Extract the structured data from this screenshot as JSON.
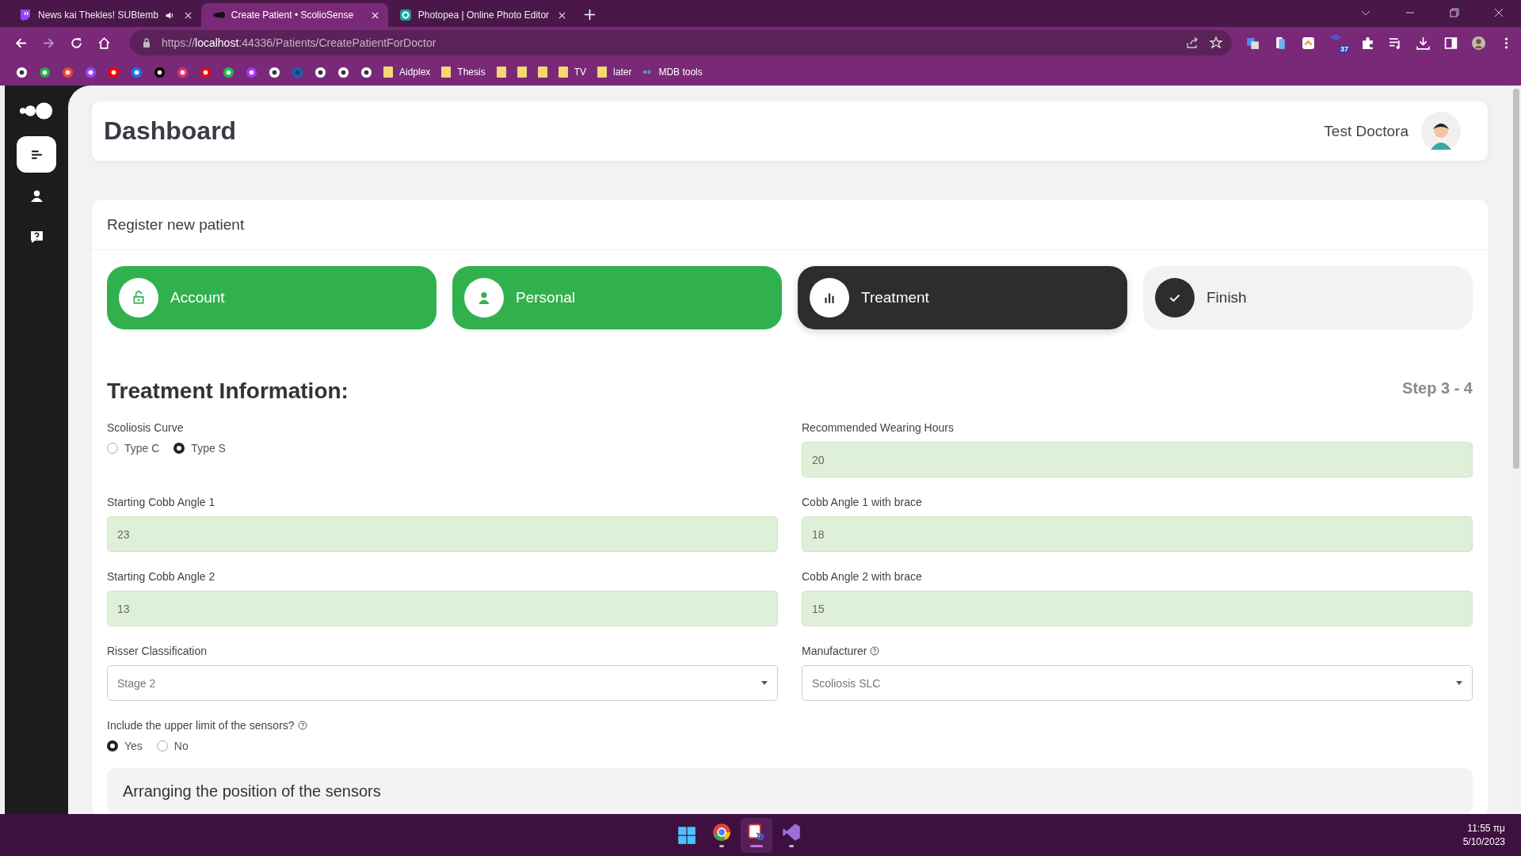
{
  "browser": {
    "tabs": [
      {
        "title": "News kai Thekles! SUBtemb",
        "kind": "stream",
        "audio": true,
        "selected": false
      },
      {
        "title": "Create Patient • ScolioSense",
        "kind": "app",
        "audio": false,
        "selected": true
      },
      {
        "title": "Photopea | Online Photo Editor",
        "kind": "editor",
        "audio": false,
        "selected": false
      }
    ],
    "url": {
      "scheme": "https://",
      "host": "localhost",
      "rest": ":44336/Patients/CreatePatientForDoctor"
    },
    "extension_badge": "37",
    "bookmarks": [
      {
        "kind": "site"
      },
      {
        "kind": "site"
      },
      {
        "kind": "site"
      },
      {
        "kind": "site"
      },
      {
        "kind": "site"
      },
      {
        "kind": "site"
      },
      {
        "kind": "site"
      },
      {
        "kind": "site"
      },
      {
        "kind": "site"
      },
      {
        "kind": "site"
      },
      {
        "kind": "site"
      },
      {
        "kind": "site"
      },
      {
        "kind": "site"
      },
      {
        "kind": "site"
      },
      {
        "kind": "site"
      },
      {
        "kind": "site"
      },
      {
        "kind": "folder",
        "label": "Aidplex"
      },
      {
        "kind": "folder",
        "label": "Thesis"
      },
      {
        "kind": "folder"
      },
      {
        "kind": "folder"
      },
      {
        "kind": "folder"
      },
      {
        "kind": "folder",
        "label": "TV"
      },
      {
        "kind": "folder",
        "label": "later"
      },
      {
        "kind": "site",
        "label": "MDB tools"
      }
    ]
  },
  "sidebar": {
    "items": [
      {
        "kind": "dashboard",
        "selected": true
      },
      {
        "kind": "profile",
        "selected": false
      },
      {
        "kind": "help",
        "selected": false
      }
    ]
  },
  "header": {
    "title": "Dashboard",
    "user": "Test Doctora"
  },
  "form": {
    "title": "Register new patient",
    "steps": [
      {
        "label": "Account",
        "completed": true,
        "selected": false
      },
      {
        "label": "Personal",
        "completed": true,
        "selected": false
      },
      {
        "label": "Treatment",
        "completed": false,
        "selected": true
      },
      {
        "label": "Finish",
        "completed": false,
        "selected": false
      }
    ],
    "section_title": "Treatment Information:",
    "step_counter": "Step 3 - 4",
    "fields": [
      {
        "kind": "radio",
        "label": "Scoliosis Curve",
        "info": false,
        "options": [
          {
            "label": "Type C",
            "selected": false
          },
          {
            "label": "Type S",
            "selected": true
          }
        ]
      },
      {
        "kind": "input",
        "label": "Recommended Wearing Hours",
        "info": false,
        "value": "20"
      },
      {
        "kind": "input",
        "label": "Starting Cobb Angle 1",
        "info": false,
        "value": "23"
      },
      {
        "kind": "input",
        "label": "Cobb Angle 1 with brace",
        "info": false,
        "value": "18"
      },
      {
        "kind": "input",
        "label": "Starting Cobb Angle 2",
        "info": false,
        "value": "13"
      },
      {
        "kind": "input",
        "label": "Cobb Angle 2 with brace",
        "info": false,
        "value": "15"
      },
      {
        "kind": "select",
        "label": "Risser Classification",
        "info": false,
        "value": "Stage 2"
      },
      {
        "kind": "select",
        "label": "Manufacturer",
        "info": true,
        "value": "Scoliosis SLC"
      },
      {
        "kind": "radio",
        "label": "Include the upper limit of the sensors?",
        "info": true,
        "options": [
          {
            "label": "Yes",
            "selected": true
          },
          {
            "label": "No",
            "selected": false
          }
        ]
      }
    ],
    "next_section": "Arranging the position of the sensors"
  },
  "taskbar": {
    "apps": [
      {
        "kind": "start",
        "running": false,
        "selected": false
      },
      {
        "kind": "browser",
        "running": true,
        "selected": false
      },
      {
        "kind": "snipping",
        "running": true,
        "selected": true
      },
      {
        "kind": "studio",
        "running": true,
        "selected": false
      }
    ],
    "time": "11:55 πμ",
    "date": "5/10/2023"
  }
}
